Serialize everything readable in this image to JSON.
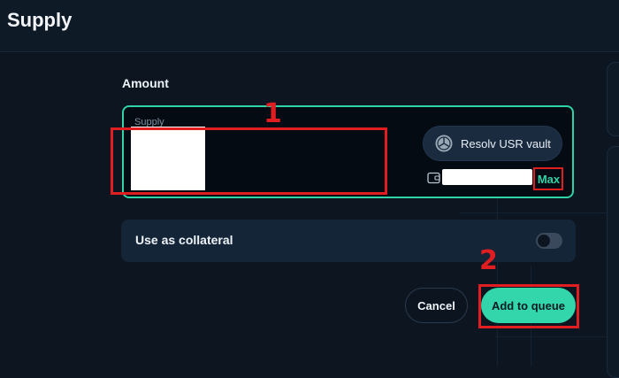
{
  "header": {
    "title": "Supply"
  },
  "amount": {
    "label": "Amount",
    "caption": "Supply",
    "token_label": "Resolv USR vault",
    "max_label": "Max"
  },
  "collateral": {
    "label": "Use as collateral",
    "enabled": false
  },
  "actions": {
    "cancel_label": "Cancel",
    "confirm_label": "Add to queue"
  },
  "annotations": [
    {
      "label": "1"
    },
    {
      "label": "2"
    }
  ],
  "colors": {
    "accent": "#2fd3a6",
    "confirm_button": "#33d6aa",
    "annotation": "#e01e22",
    "background": "#0c1520"
  },
  "icons": {
    "token": "resolv-token-icon",
    "wallet": "wallet-icon"
  }
}
